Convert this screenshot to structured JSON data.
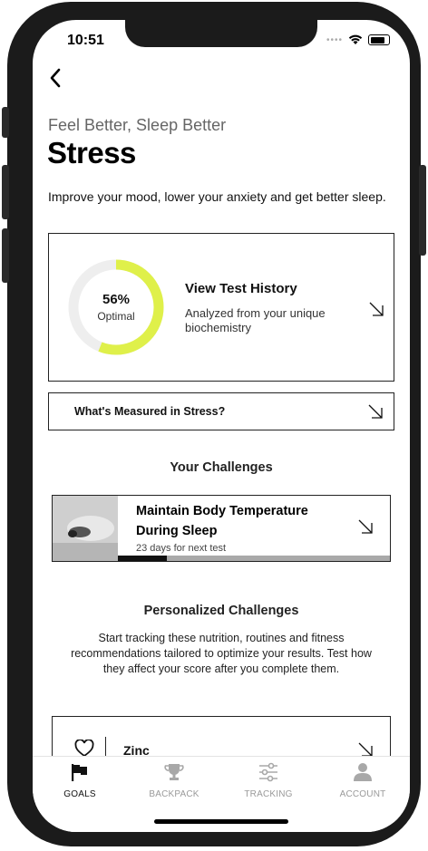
{
  "status_bar": {
    "time": "10:51"
  },
  "header": {
    "subtitle": "Feel Better, Sleep Better",
    "title": "Stress",
    "description": "Improve your mood, lower your anxiety and get better sleep."
  },
  "score_card": {
    "percent_label": "56%",
    "percent_value": 56,
    "status": "Optimal",
    "link_title": "View Test History",
    "link_subtitle": "Analyzed from your unique biochemistry",
    "ring_color": "#dff04a"
  },
  "measured_link": {
    "label": "What's Measured in Stress?"
  },
  "your_challenges": {
    "heading": "Your Challenges",
    "items": [
      {
        "title": "Maintain Body Temperature During Sleep",
        "meta": "23 days for next test",
        "progress": 0.18
      }
    ]
  },
  "personalized": {
    "heading": "Personalized Challenges",
    "text": "Start tracking these nutrition, routines and fitness recommendations tailored to optimize your results. Test how they affect your score after you complete them.",
    "items": [
      {
        "label": "Zinc"
      }
    ]
  },
  "tabbar": {
    "tabs": [
      {
        "label": "GOALS",
        "icon": "flag-icon",
        "active": true
      },
      {
        "label": "BACKPACK",
        "icon": "trophy-icon",
        "active": false
      },
      {
        "label": "TRACKING",
        "icon": "sliders-icon",
        "active": false
      },
      {
        "label": "ACCOUNT",
        "icon": "person-icon",
        "active": false
      }
    ]
  }
}
